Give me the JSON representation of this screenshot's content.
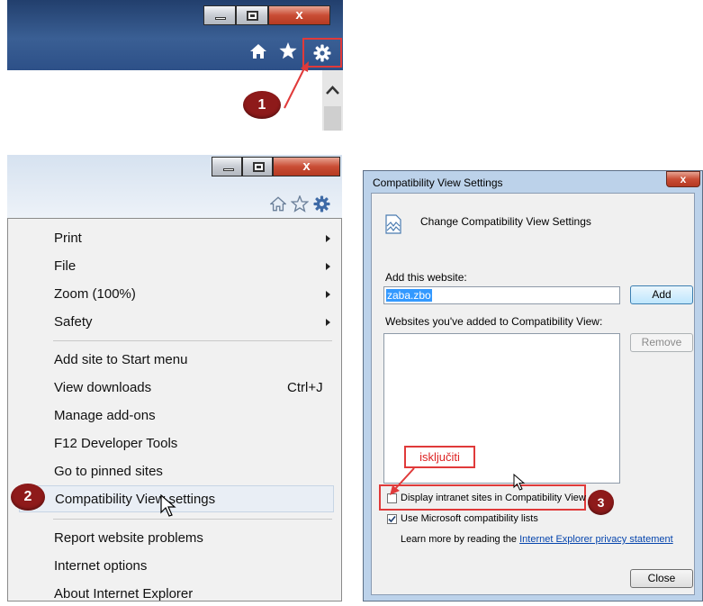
{
  "top": {
    "window_buttons": {
      "minimize": "",
      "maximize": "",
      "close": "x"
    },
    "toolbar_icons": [
      "home-icon",
      "star-icon",
      "gear-icon"
    ],
    "step": "1"
  },
  "menu": {
    "items": [
      {
        "label": "Print",
        "submenu": true
      },
      {
        "label": "File",
        "submenu": true
      },
      {
        "label": "Zoom (100%)",
        "submenu": true
      },
      {
        "label": "Safety",
        "submenu": true
      },
      {
        "label": "Add site to Start menu"
      },
      {
        "label": "View downloads",
        "shortcut": "Ctrl+J"
      },
      {
        "label": "Manage add-ons"
      },
      {
        "label": "F12 Developer Tools"
      },
      {
        "label": "Go to pinned sites"
      },
      {
        "label": "Compatibility View settings"
      },
      {
        "label": "Report website problems"
      },
      {
        "label": "Internet options"
      },
      {
        "label": "About Internet Explorer"
      }
    ],
    "step": "2"
  },
  "dialog": {
    "title": "Compatibility View Settings",
    "close_label": "x",
    "heading": "Change Compatibility View Settings",
    "add_label": "Add this website:",
    "add_value": "zaba.zbo",
    "add_button": "Add",
    "list_label": "Websites you've added to Compatibility View:",
    "remove_button": "Remove",
    "callout": "isključiti",
    "check_intranet": {
      "label": "Display intranet sites in Compatibility View",
      "checked": false
    },
    "check_ms": {
      "label": "Use Microsoft compatibility lists",
      "checked": true
    },
    "learn_prefix": "Learn more by reading the",
    "learn_link": "Internet Explorer privacy statement",
    "close_button": "Close",
    "step": "3"
  },
  "colors": {
    "accent_red": "#e03a3a",
    "step_badge": "#8e1a1a",
    "selection_blue": "#3399ff"
  }
}
